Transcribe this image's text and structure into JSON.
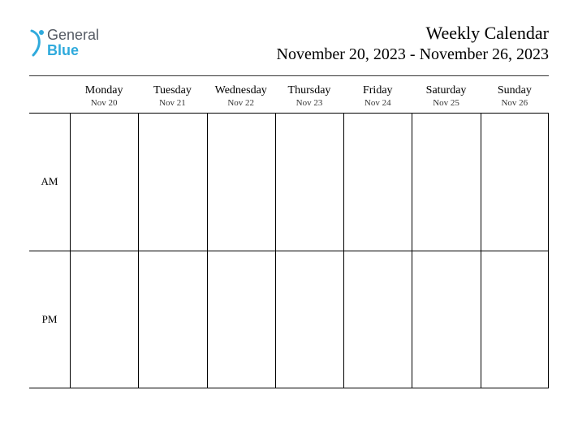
{
  "logo": {
    "general": "General",
    "blue": "Blue"
  },
  "title": {
    "main": "Weekly Calendar",
    "range": "November 20, 2023 - November 26, 2023"
  },
  "days": [
    {
      "name": "Monday",
      "date": "Nov 20"
    },
    {
      "name": "Tuesday",
      "date": "Nov 21"
    },
    {
      "name": "Wednesday",
      "date": "Nov 22"
    },
    {
      "name": "Thursday",
      "date": "Nov 23"
    },
    {
      "name": "Friday",
      "date": "Nov 24"
    },
    {
      "name": "Saturday",
      "date": "Nov 25"
    },
    {
      "name": "Sunday",
      "date": "Nov 26"
    }
  ],
  "periods": {
    "am": "AM",
    "pm": "PM"
  }
}
